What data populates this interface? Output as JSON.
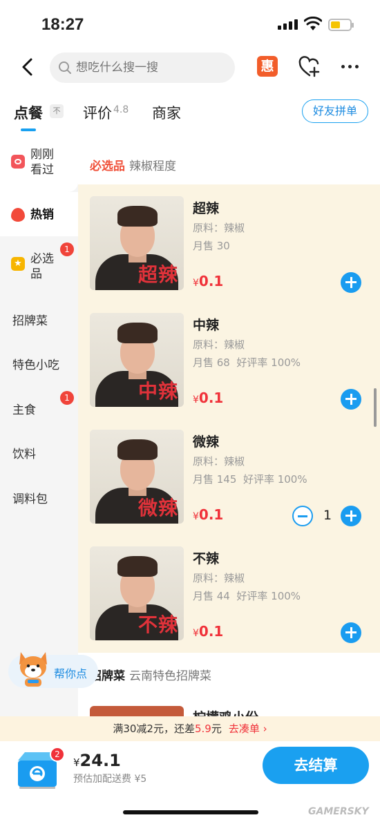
{
  "status": {
    "time": "18:27"
  },
  "header": {
    "search_placeholder": "想吃什么搜一搜",
    "hui": "惠"
  },
  "tabs": {
    "order": "点餐",
    "order_badge": "不",
    "review": "评价",
    "review_score": "4.8",
    "shop": "商家",
    "friend_order": "好友拼单"
  },
  "sidebar": {
    "recent": "刚刚看过",
    "hot": "热销",
    "must": "必选品",
    "must_badge": "1",
    "signature": "招牌菜",
    "snacks": "特色小吃",
    "staple": "主食",
    "staple_badge": "1",
    "drinks": "饮料",
    "sauce": "调料包"
  },
  "section": {
    "title": "必选品",
    "subtitle": "辣椒程度"
  },
  "items": [
    {
      "name": "超辣",
      "material": "原料：辣椒",
      "sold": "月售 30",
      "rating": "",
      "price": "0.1",
      "caption": "超辣"
    },
    {
      "name": "中辣",
      "material": "原料：辣椒",
      "sold": "月售 68",
      "rating": "好评率 100%",
      "price": "0.1",
      "caption": "中辣"
    },
    {
      "name": "微辣",
      "material": "原料：辣椒",
      "sold": "月售 145",
      "rating": "好评率 100%",
      "price": "0.1",
      "caption": "微辣",
      "qty": "1"
    },
    {
      "name": "不辣",
      "material": "原料：辣椒",
      "sold": "月售 44",
      "rating": "好评率 100%",
      "price": "0.1",
      "caption": "不辣"
    }
  ],
  "section2": {
    "title": "招牌菜",
    "subtitle": "云南特色招牌菜",
    "next_item": "柠檬鸡小份"
  },
  "helper": {
    "label": "帮你点"
  },
  "promo": {
    "prefix": "满30减2元，还差",
    "amount": "5.9",
    "unit": "元",
    "action": "去凑单 ›"
  },
  "cart": {
    "badge": "2",
    "total": "24.1",
    "fee": "预估加配送费 ¥5",
    "checkout": "去结算"
  },
  "currency": "¥",
  "watermark": "GAMERSKY"
}
